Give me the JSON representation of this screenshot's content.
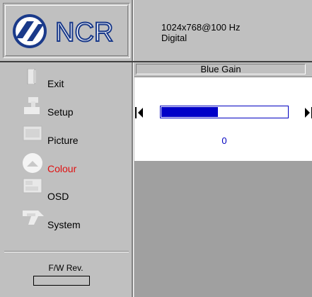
{
  "header": {
    "logo_text": "NCR",
    "resolution": "1024x768@100 Hz",
    "signal": "Digital"
  },
  "sidebar": {
    "items": [
      {
        "label": "Exit",
        "icon": "door-icon"
      },
      {
        "label": "Setup",
        "icon": "setup-icon"
      },
      {
        "label": "Picture",
        "icon": "picture-icon"
      },
      {
        "label": "Colour",
        "icon": "colour-icon",
        "active": true
      },
      {
        "label": "OSD",
        "icon": "osd-icon"
      },
      {
        "label": "System",
        "icon": "system-icon"
      }
    ],
    "fw_label": "F/W Rev.",
    "fw_value": ""
  },
  "panel": {
    "title": "Blue Gain",
    "slider_fraction": 0.45,
    "value": "0"
  },
  "colors": {
    "background": "#c0c0c0",
    "active_text": "#e01010",
    "slider": "#0000c8",
    "value_text": "#0000c0",
    "empty_area": "#a0a0a0"
  }
}
